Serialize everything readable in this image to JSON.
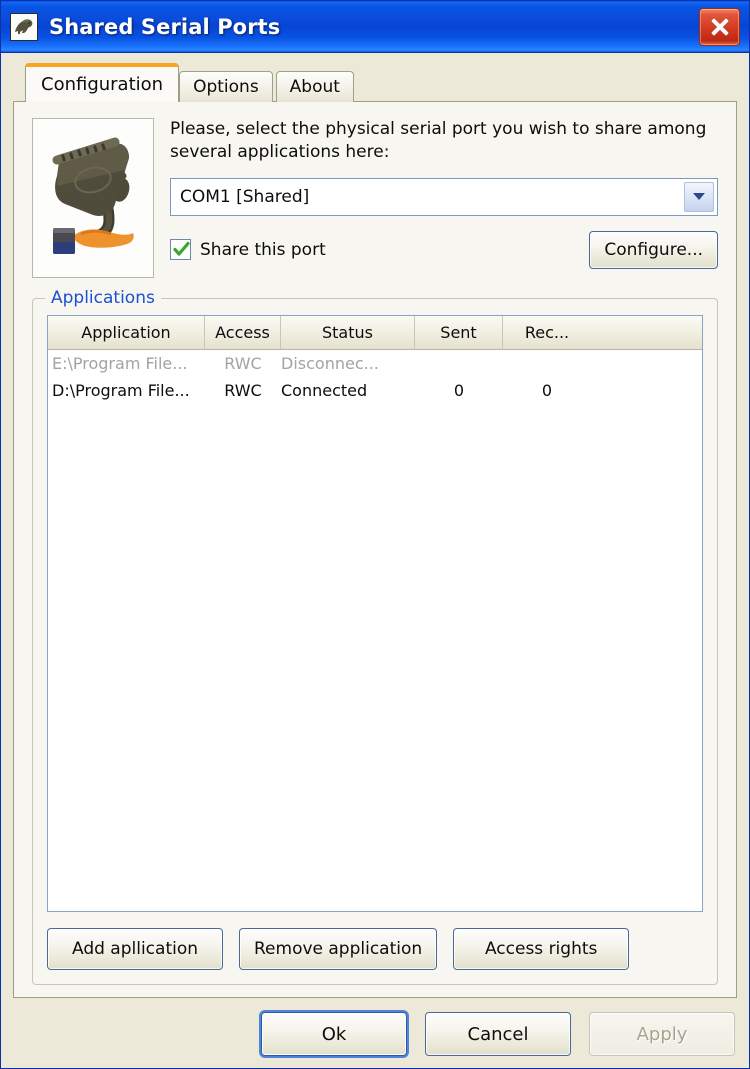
{
  "window": {
    "title": "Shared Serial Ports",
    "icon": "app-icon",
    "close_label": "Close",
    "titlebar_color": "#0a4ddc",
    "body_color": "#ece9d8",
    "panel_color": "#f7f6f1"
  },
  "tabs": [
    {
      "label": "Configuration",
      "active": true
    },
    {
      "label": "Options",
      "active": false
    },
    {
      "label": "About",
      "active": false
    }
  ],
  "configuration": {
    "port_icon": "serial-port-connector-icon",
    "instruction": "Please, select the physical serial port you wish to share among several applications here:",
    "port_select": {
      "value": "COM1 [Shared]",
      "options": [
        "COM1 [Shared]"
      ]
    },
    "share_checkbox": {
      "label": "Share this port",
      "checked": true,
      "check_color": "#3aa62e"
    },
    "configure_button": "Configure..."
  },
  "applications_group": {
    "legend": "Applications",
    "legend_color": "#1b50cf",
    "columns": [
      "Application",
      "Access",
      "Status",
      "Sent",
      "Rec..."
    ],
    "rows": [
      {
        "application": "E:\\Program File...",
        "access": "RWC",
        "status": "Disconnec...",
        "sent": "",
        "rec": "",
        "disabled": true
      },
      {
        "application": "D:\\Program File...",
        "access": "RWC",
        "status": "Connected",
        "sent": "0",
        "rec": "0",
        "disabled": false
      }
    ],
    "buttons": {
      "add": "Add apllication",
      "remove": "Remove application",
      "access_rights": "Access rights"
    }
  },
  "footer": {
    "ok": "Ok",
    "cancel": "Cancel",
    "apply": "Apply",
    "apply_disabled": true
  }
}
